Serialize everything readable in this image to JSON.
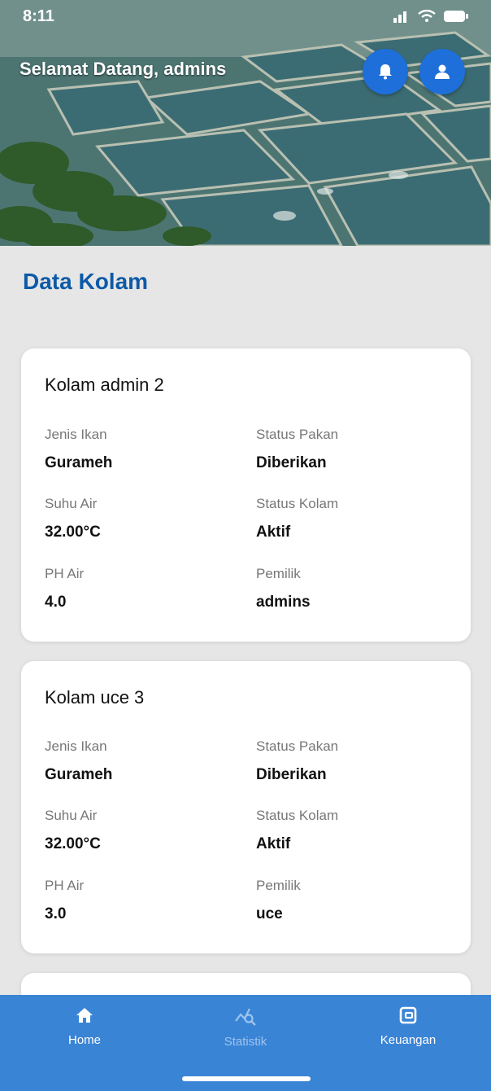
{
  "status_bar": {
    "time": "8:11"
  },
  "header": {
    "welcome": "Selamat Datang, admins"
  },
  "page": {
    "section_title": "Data Kolam"
  },
  "ponds": [
    {
      "name": "Kolam admin 2",
      "fish_type_label": "Jenis Ikan",
      "fish_type": "Gurameh",
      "feed_status_label": "Status Pakan",
      "feed_status": "Diberikan",
      "water_temp_label": "Suhu Air",
      "water_temp": "32.00°C",
      "pond_status_label": "Status Kolam",
      "pond_status": "Aktif",
      "ph_label": "PH Air",
      "ph": "4.0",
      "owner_label": "Pemilik",
      "owner": "admins"
    },
    {
      "name": "Kolam uce 3",
      "fish_type_label": "Jenis Ikan",
      "fish_type": "Gurameh",
      "feed_status_label": "Status Pakan",
      "feed_status": "Diberikan",
      "water_temp_label": "Suhu Air",
      "water_temp": "32.00°C",
      "pond_status_label": "Status Kolam",
      "pond_status": "Aktif",
      "ph_label": "PH Air",
      "ph": "3.0",
      "owner_label": "Pemilik",
      "owner": "uce"
    }
  ],
  "bottom_nav": {
    "items": [
      {
        "label": "Home",
        "icon": "home-icon"
      },
      {
        "label": "Statistik",
        "icon": "statistics-icon"
      },
      {
        "label": "Keuangan",
        "icon": "wallet-icon"
      }
    ]
  },
  "colors": {
    "primary": "#1e6fd9",
    "title_blue": "#0d5aa7",
    "nav_bg": "#3a84d6"
  }
}
